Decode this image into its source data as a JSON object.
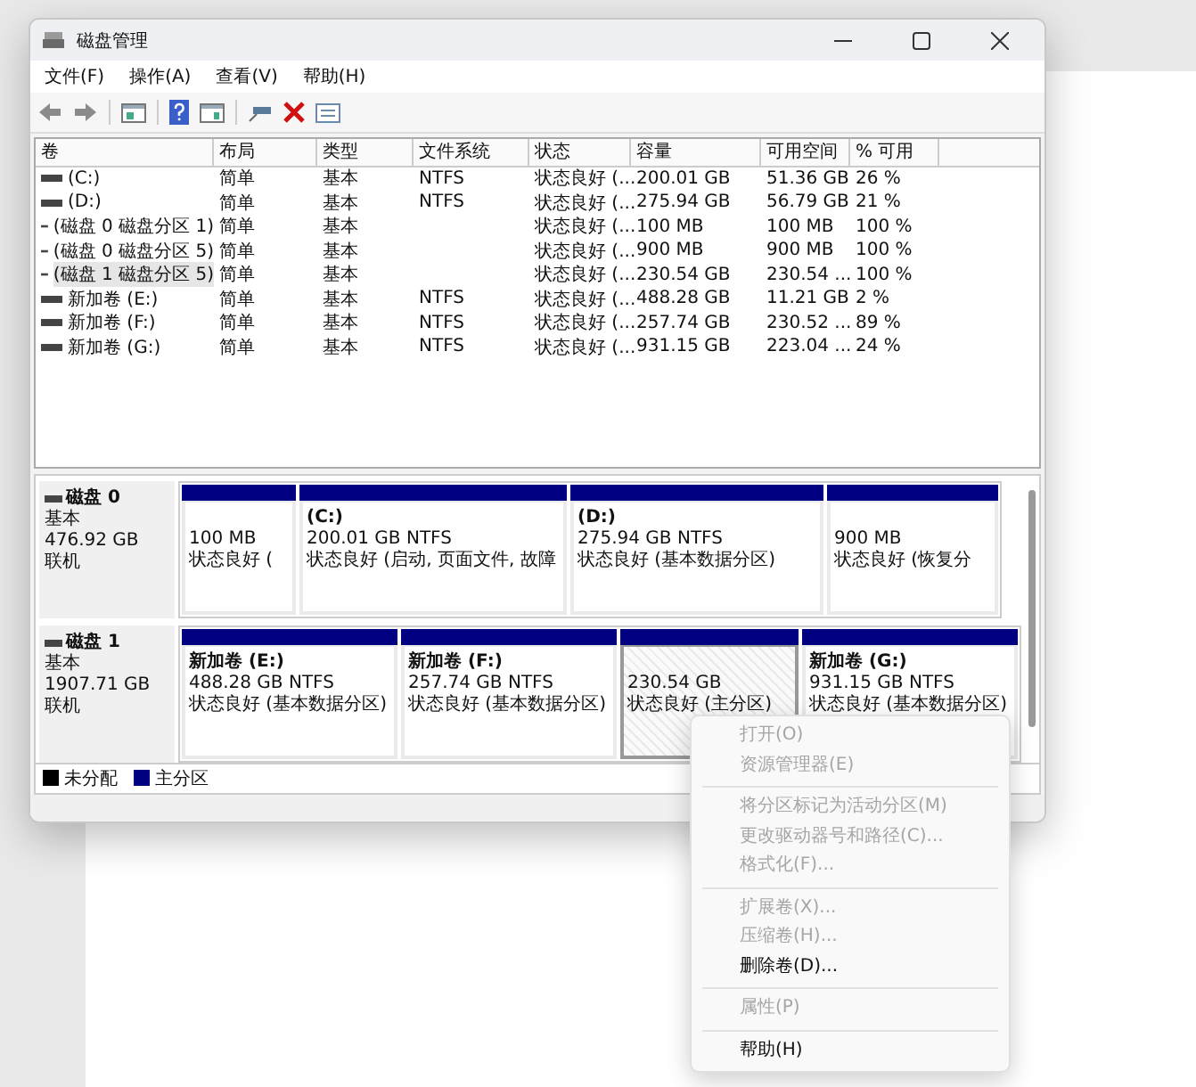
{
  "window": {
    "title": "磁盘管理"
  },
  "menu_bar": [
    {
      "label": "文件(F)"
    },
    {
      "label": "操作(A)"
    },
    {
      "label": "查看(V)"
    },
    {
      "label": "帮助(H)"
    }
  ],
  "volume_table": {
    "columns": [
      "卷",
      "布局",
      "类型",
      "文件系统",
      "状态",
      "容量",
      "可用空间",
      "% 可用"
    ],
    "rows": [
      {
        "selected": false,
        "cells": [
          "(C:)",
          "简单",
          "基本",
          "NTFS",
          "状态良好 (...",
          "200.01 GB",
          "51.36 GB",
          "26 %"
        ]
      },
      {
        "selected": false,
        "cells": [
          "(D:)",
          "简单",
          "基本",
          "NTFS",
          "状态良好 (...",
          "275.94 GB",
          "56.79 GB",
          "21 %"
        ]
      },
      {
        "selected": false,
        "cells": [
          "(磁盘 0 磁盘分区 1)",
          "简单",
          "基本",
          "",
          "状态良好 (...",
          "100 MB",
          "100 MB",
          "100 %"
        ]
      },
      {
        "selected": false,
        "cells": [
          "(磁盘 0 磁盘分区 5)",
          "简单",
          "基本",
          "",
          "状态良好 (...",
          "900 MB",
          "900 MB",
          "100 %"
        ]
      },
      {
        "selected": true,
        "cells": [
          "(磁盘 1 磁盘分区 5)",
          "简单",
          "基本",
          "",
          "状态良好 (...",
          "230.54 GB",
          "230.54 ...",
          "100 %"
        ]
      },
      {
        "selected": false,
        "cells": [
          "新加卷 (E:)",
          "简单",
          "基本",
          "NTFS",
          "状态良好 (...",
          "488.28 GB",
          "11.21 GB",
          "2 %"
        ]
      },
      {
        "selected": false,
        "cells": [
          "新加卷 (F:)",
          "简单",
          "基本",
          "NTFS",
          "状态良好 (...",
          "257.74 GB",
          "230.52 ...",
          "89 %"
        ]
      },
      {
        "selected": false,
        "cells": [
          "新加卷 (G:)",
          "简单",
          "基本",
          "NTFS",
          "状态良好 (...",
          "931.15 GB",
          "223.04 ...",
          "24 %"
        ]
      }
    ]
  },
  "disks": [
    {
      "name": "磁盘 0",
      "type": "基本",
      "size": "476.92 GB",
      "status": "联机",
      "partitions": [
        {
          "size": "100 MB",
          "status": "状态良好 (",
          "selected": false
        },
        {
          "label": "(C:)",
          "size": "200.01 GB NTFS",
          "status": "状态良好 (启动, 页面文件, 故障",
          "selected": false
        },
        {
          "label": "(D:)",
          "size": "275.94 GB NTFS",
          "status": "状态良好 (基本数据分区)",
          "selected": false
        },
        {
          "size": "900 MB",
          "status": "状态良好 (恢复分",
          "selected": false
        }
      ]
    },
    {
      "name": "磁盘 1",
      "type": "基本",
      "size": "1907.71 GB",
      "status": "联机",
      "partitions": [
        {
          "label": "新加卷  (E:)",
          "size": "488.28 GB NTFS",
          "status": "状态良好 (基本数据分区)",
          "selected": false
        },
        {
          "label": "新加卷  (F:)",
          "size": "257.74 GB NTFS",
          "status": "状态良好 (基本数据分区)",
          "selected": false
        },
        {
          "size": "230.54 GB",
          "status": "状态良好 (主分区)",
          "selected": true
        },
        {
          "label": "新加卷  (G:)",
          "size": "931.15 GB NTFS",
          "status": "状态良好 (基本数据分区)",
          "selected": false
        }
      ]
    }
  ],
  "legend": [
    {
      "label": "未分配",
      "color": "#000000"
    },
    {
      "label": "主分区",
      "color": "#000080"
    }
  ],
  "context_menu": {
    "groups": [
      [
        {
          "label": "打开(O)",
          "disabled": true
        },
        {
          "label": "资源管理器(E)",
          "disabled": true
        }
      ],
      [
        {
          "label": "将分区标记为活动分区(M)",
          "disabled": true
        },
        {
          "label": "更改驱动器号和路径(C)...",
          "disabled": true
        },
        {
          "label": "格式化(F)...",
          "disabled": true
        }
      ],
      [
        {
          "label": "扩展卷(X)...",
          "disabled": true
        },
        {
          "label": "压缩卷(H)...",
          "disabled": true
        },
        {
          "label": "删除卷(D)...",
          "disabled": false
        }
      ],
      [
        {
          "label": "属性(P)",
          "disabled": true
        }
      ],
      [
        {
          "label": "帮助(H)",
          "disabled": false
        }
      ]
    ]
  }
}
